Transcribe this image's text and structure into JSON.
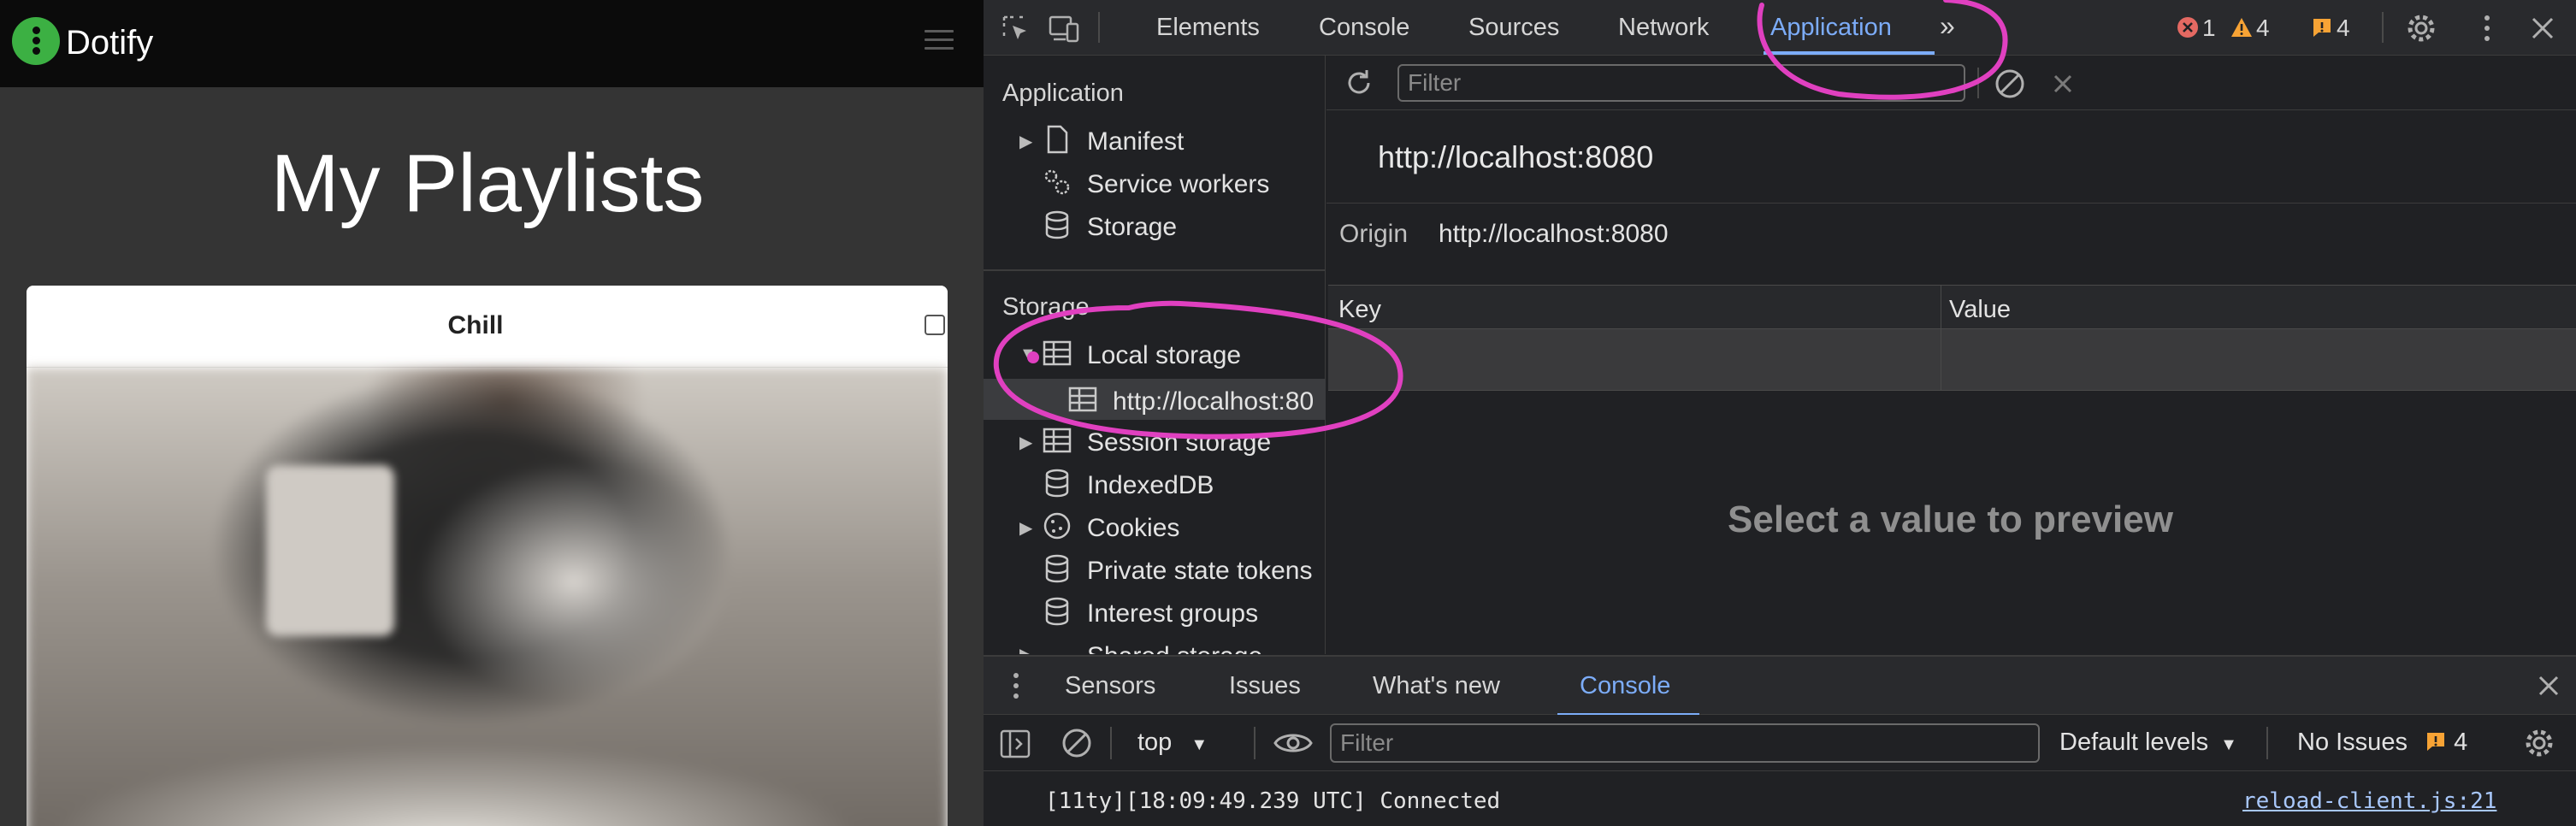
{
  "app": {
    "brand": "Dotify",
    "title": "My Playlists",
    "card": {
      "title": "Chill"
    }
  },
  "devtools": {
    "tabs": [
      "Elements",
      "Console",
      "Sources",
      "Network",
      "Application"
    ],
    "more_tabs_icon": "chevron-double-right-icon",
    "badges": {
      "errors": "1",
      "warnings": "4",
      "issues": "4"
    },
    "sidebar": {
      "section_application": "Application",
      "section_storage": "Storage",
      "items": {
        "manifest": "Manifest",
        "service_workers": "Service workers",
        "storage": "Storage",
        "local_storage": "Local storage",
        "local_storage_origin": "http://localhost:80",
        "session_storage": "Session storage",
        "indexeddb": "IndexedDB",
        "cookies": "Cookies",
        "private_state_tokens": "Private state tokens",
        "interest_groups": "Interest groups",
        "shared_storage": "Shared storage"
      }
    },
    "main": {
      "filter_placeholder": "Filter",
      "origin_title": "http://localhost:8080",
      "origin_label": "Origin",
      "origin_value": "http://localhost:8080",
      "columns": {
        "key": "Key",
        "value": "Value"
      },
      "preview_text": "Select a value to preview"
    },
    "drawer": {
      "tabs": [
        "Sensors",
        "Issues",
        "What's new",
        "Console"
      ],
      "active_tab": "Console",
      "context": "top",
      "filter_placeholder": "Filter",
      "levels": "Default levels",
      "no_issues": "No Issues",
      "issues_count": "4",
      "message": "[11ty][18:09:49.239 UTC] Connected",
      "message_source": "reload-client.js:21"
    },
    "colors": {
      "accent": "#7cacf8",
      "annotation": "#e040c0",
      "brand_green": "#3cb043"
    }
  }
}
